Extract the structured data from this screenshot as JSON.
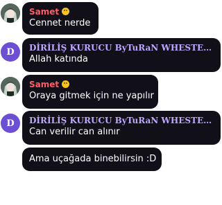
{
  "messages": [
    {
      "sender": "Samet",
      "text": "Cennet nerde",
      "avatar": "photo",
      "emoji": "smile-emoji"
    },
    {
      "sender": "DİRİLİŞ KURUCU ByTuRaN WHESTER...",
      "text": "Allah katında",
      "avatar_letter": "D"
    },
    {
      "sender": "Samet",
      "text": "Oraya gitmek için ne yapılır",
      "avatar": "photo",
      "emoji": "smile-emoji"
    },
    {
      "sender": "DİRİLİŞ KURUCU ByTuRaN WHESTER...",
      "text": "Can verilir can alınır",
      "avatar_letter": "D"
    },
    {
      "sender": "",
      "text": "Ama uçağada binebilirsin :D"
    }
  ],
  "colors": {
    "bubble": "#111019",
    "samet_name": "#ff5c67",
    "dirilis_name": "#bfa6ff",
    "avatar_letter_bg": "#6d4fd4"
  }
}
